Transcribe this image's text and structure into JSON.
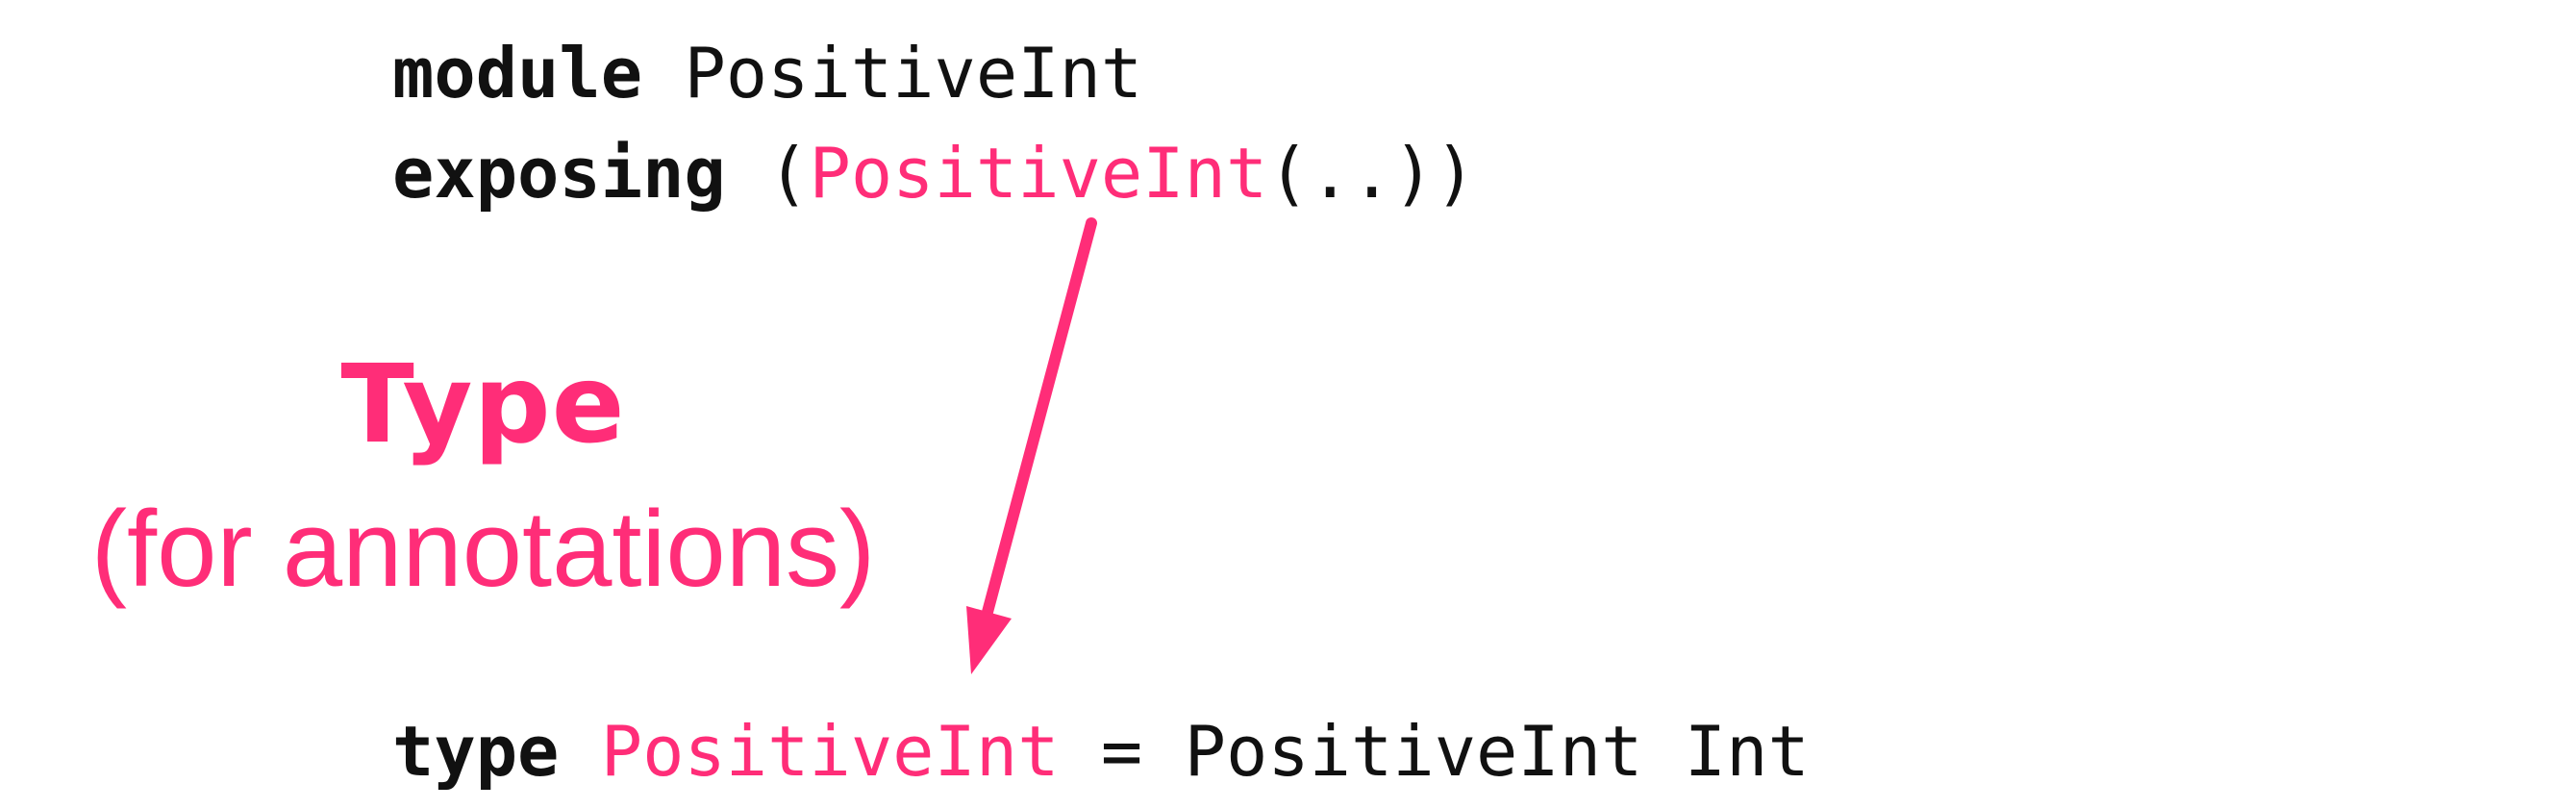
{
  "colors": {
    "accent": "#ff2d78",
    "text": "#111111"
  },
  "code": {
    "line1": {
      "keyword": "module",
      "rest": " PositiveInt"
    },
    "line2": {
      "keyword": "exposing",
      "open": " (",
      "highlight": "PositiveInt",
      "close": "(..))"
    },
    "line3": {
      "keyword": "type",
      "space": " ",
      "highlight": "PositiveInt",
      "rest": " = PositiveInt Int"
    }
  },
  "callout": {
    "title": "Type",
    "subtitle": "(for annotations)"
  }
}
